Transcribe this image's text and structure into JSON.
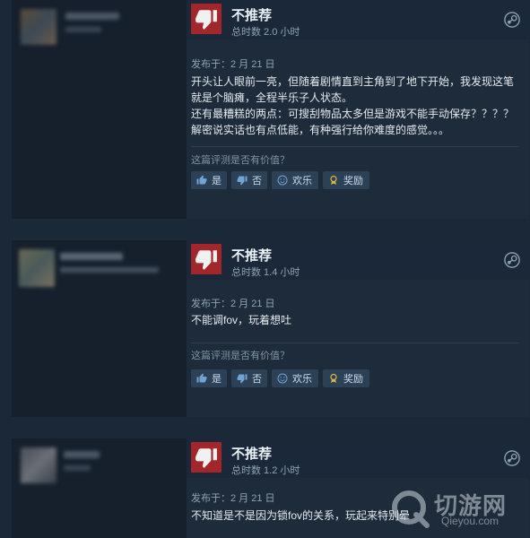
{
  "reviews": [
    {
      "verdict": "不推荐",
      "hours": "总时数 2.0 小时",
      "posted": "发布于：2 月 21 日",
      "body_lines": [
        "开头让人眼前一亮，但随着剧情直到主角到了地下开始，我发现这笔",
        "就是个脑瘫，全程半乐子人状态。",
        "还有最糟糕的两点：可搜刮物品太多但是游戏不能手动保存？？？？",
        "解密说实话也有点低能，有种强行给你难度的感觉。。。"
      ],
      "helpful_q": "这篇评测是否有价值？",
      "buttons": {
        "yes": "是",
        "no": "否",
        "funny": "欢乐",
        "award": "奖励"
      }
    },
    {
      "verdict": "不推荐",
      "hours": "总时数 1.4 小时",
      "posted": "发布于：2 月 21 日",
      "body_lines": [
        "不能调fov，玩着想吐"
      ],
      "helpful_q": "这篇评测是否有价值？",
      "buttons": {
        "yes": "是",
        "no": "否",
        "funny": "欢乐",
        "award": "奖励"
      }
    },
    {
      "verdict": "不推荐",
      "hours": "总时数 1.2 小时",
      "posted": "发布于：2 月 21 日",
      "body_lines": [
        "不知道是不是因为锁fov的关系，玩起来特别晕"
      ]
    }
  ],
  "watermark": {
    "text": "切游网",
    "url": "Qieyou.com"
  },
  "icons": {
    "verdict": "thumbs-down-icon",
    "platform": "steam-icon",
    "yes": "thumbs-up-icon",
    "no": "thumbs-down-small-icon",
    "funny": "smile-icon",
    "award": "award-icon"
  },
  "colors": {
    "not_recommended": "#a3262b",
    "background": "#1b2838",
    "button": "#2d4156"
  }
}
